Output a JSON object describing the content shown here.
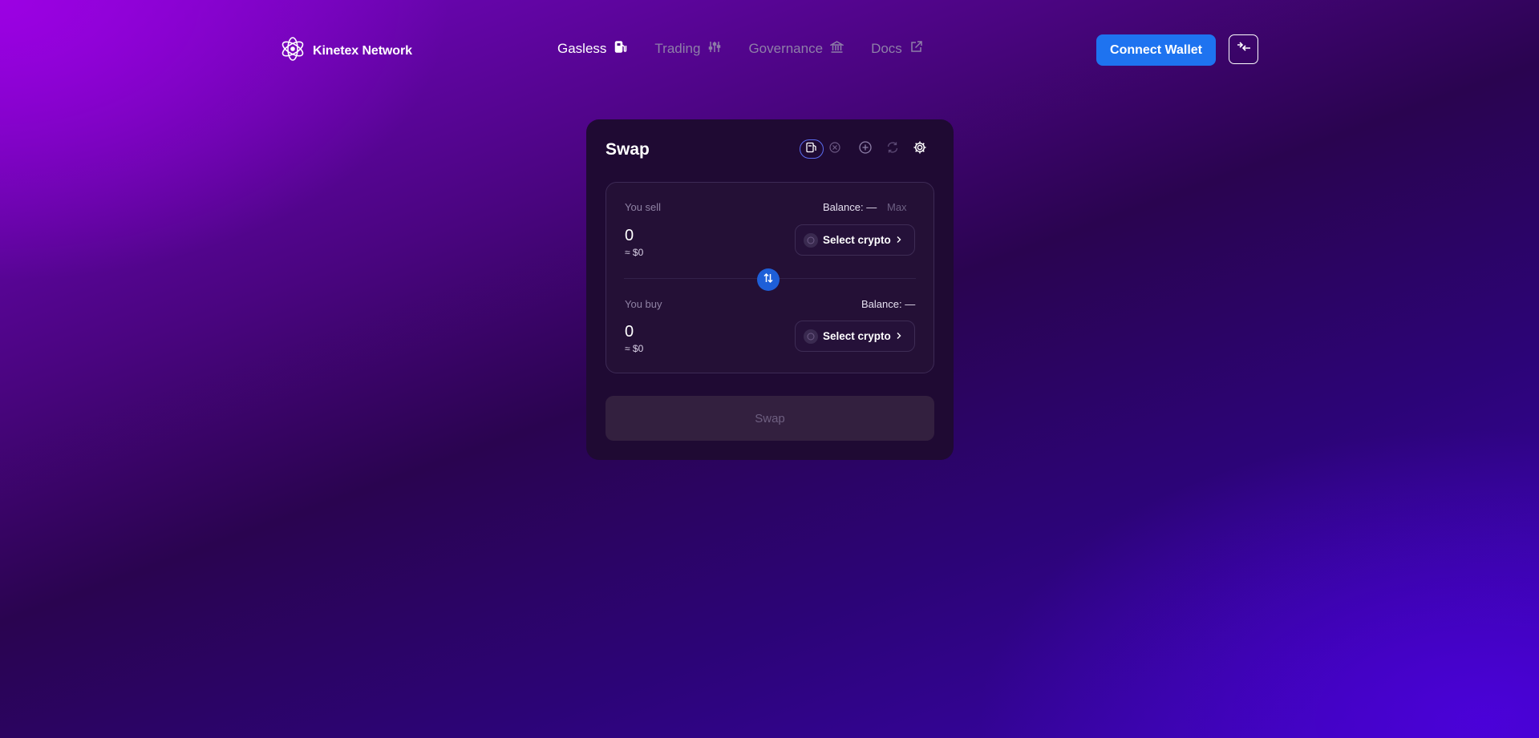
{
  "header": {
    "brand": "Kinetex Network",
    "nav": [
      {
        "label": "Gasless",
        "icon": "fuel-pump-icon",
        "active": true
      },
      {
        "label": "Trading",
        "icon": "sliders-icon",
        "active": false
      },
      {
        "label": "Governance",
        "icon": "bank-icon",
        "active": false
      },
      {
        "label": "Docs",
        "icon": "external-link-icon",
        "active": false
      }
    ],
    "connect_label": "Connect Wallet"
  },
  "swap": {
    "title": "Swap",
    "sell": {
      "label": "You sell",
      "balance": "Balance: —",
      "max": "Max",
      "amount": "0",
      "usd": "≈ $0",
      "select": "Select crypto"
    },
    "buy": {
      "label": "You buy",
      "balance": "Balance: —",
      "amount": "0",
      "usd": "≈ $0",
      "select": "Select crypto"
    },
    "button": "Swap"
  },
  "colors": {
    "accent": "#1e73f0",
    "card": "#1f0a33",
    "switch": "#1e5fd8"
  }
}
